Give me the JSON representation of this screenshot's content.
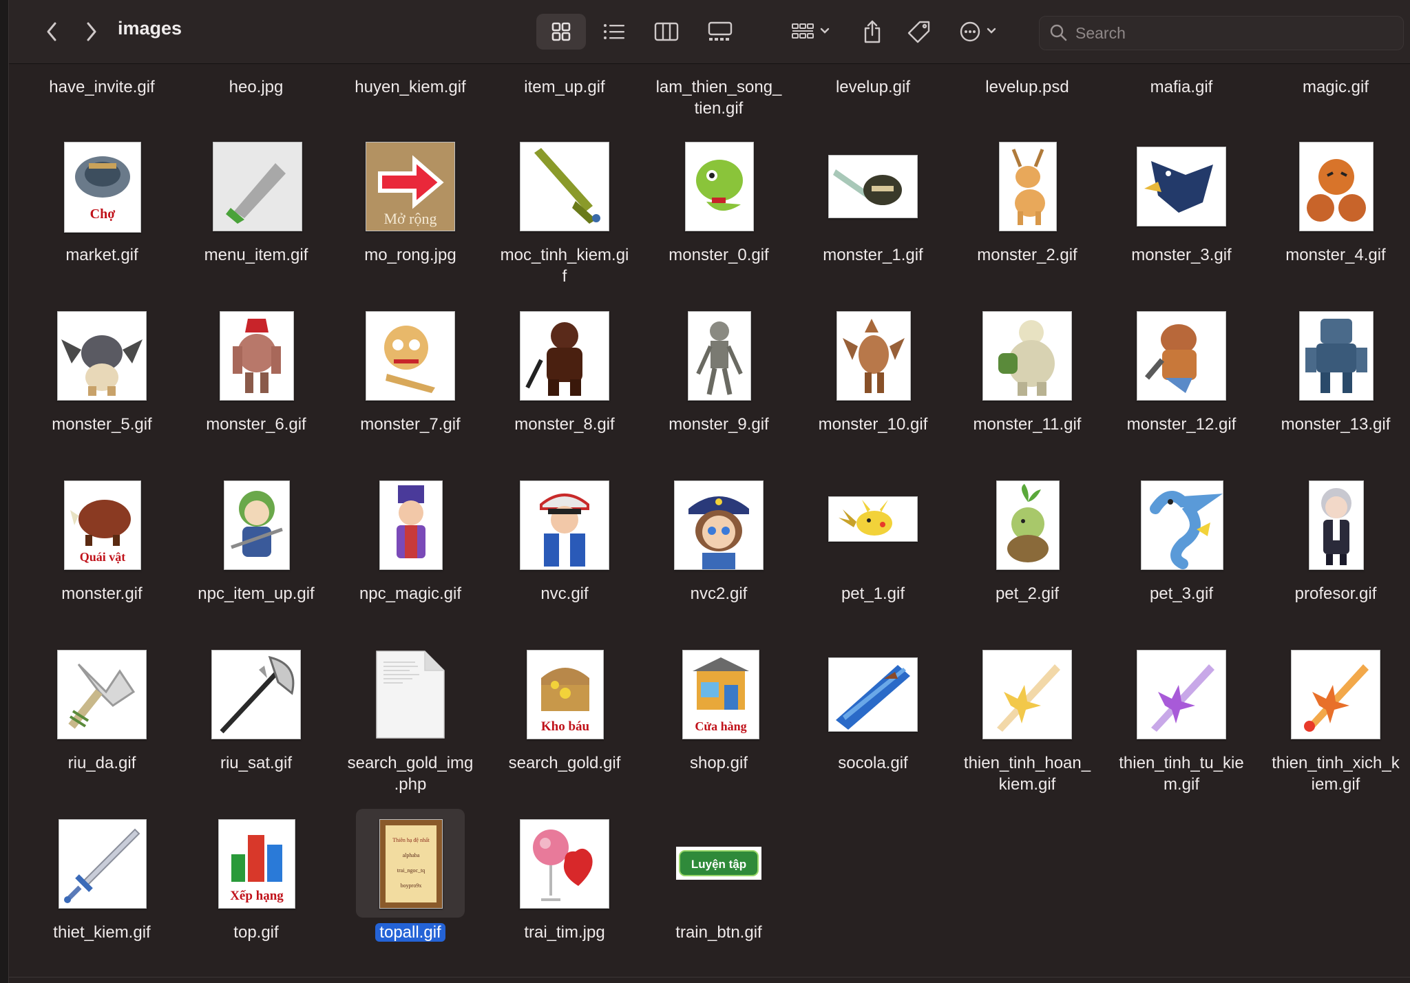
{
  "window": {
    "title": "images"
  },
  "toolbar": {
    "back_icon": "chevron-left-icon",
    "forward_icon": "chevron-right-icon",
    "views": [
      "icon-view-icon",
      "list-view-icon",
      "column-view-icon",
      "gallery-view-icon"
    ],
    "group_icon": "group-icon",
    "share_icon": "share-icon",
    "tag_icon": "tag-icon",
    "more_icon": "more-icon"
  },
  "search": {
    "placeholder": "Search"
  },
  "files": [
    {
      "name": "have_invite.gif"
    },
    {
      "name": "heo.jpg"
    },
    {
      "name": "huyen_kiem.gif"
    },
    {
      "name": "item_up.gif"
    },
    {
      "name": "lam_thien_song_\ntien.gif"
    },
    {
      "name": "levelup.gif"
    },
    {
      "name": "levelup.psd"
    },
    {
      "name": "mafia.gif"
    },
    {
      "name": "magic.gif"
    },
    {
      "name": "market.gif",
      "thumb_text": "Chợ"
    },
    {
      "name": "menu_item.gif"
    },
    {
      "name": "mo_rong.jpg",
      "thumb_text": "Mở rộng"
    },
    {
      "name": "moc_tinh_kiem.gi\nf"
    },
    {
      "name": "monster_0.gif"
    },
    {
      "name": "monster_1.gif"
    },
    {
      "name": "monster_2.gif"
    },
    {
      "name": "monster_3.gif"
    },
    {
      "name": "monster_4.gif"
    },
    {
      "name": "monster_5.gif"
    },
    {
      "name": "monster_6.gif"
    },
    {
      "name": "monster_7.gif"
    },
    {
      "name": "monster_8.gif"
    },
    {
      "name": "monster_9.gif"
    },
    {
      "name": "monster_10.gif"
    },
    {
      "name": "monster_11.gif"
    },
    {
      "name": "monster_12.gif"
    },
    {
      "name": "monster_13.gif"
    },
    {
      "name": "monster.gif",
      "thumb_text": "Quái vật"
    },
    {
      "name": "npc_item_up.gif"
    },
    {
      "name": "npc_magic.gif"
    },
    {
      "name": "nvc.gif"
    },
    {
      "name": "nvc2.gif"
    },
    {
      "name": "pet_1.gif"
    },
    {
      "name": "pet_2.gif"
    },
    {
      "name": "pet_3.gif"
    },
    {
      "name": "profesor.gif"
    },
    {
      "name": "riu_da.gif"
    },
    {
      "name": "riu_sat.gif"
    },
    {
      "name": "search_gold_img\n.php"
    },
    {
      "name": "search_gold.gif",
      "thumb_text": "Kho báu"
    },
    {
      "name": "shop.gif",
      "thumb_text": "Cửa hàng"
    },
    {
      "name": "socola.gif"
    },
    {
      "name": "thien_tinh_hoan_\nkiem.gif"
    },
    {
      "name": "thien_tinh_tu_kie\nm.gif"
    },
    {
      "name": "thien_tinh_xich_k\niem.gif"
    },
    {
      "name": "thiet_kiem.gif"
    },
    {
      "name": "top.gif",
      "thumb_text": "Xếp hạng"
    },
    {
      "name": "topall.gif",
      "selected": true,
      "thumb_text": "Thiên hạ đệ nhất\nalphaba\ntrai_ngoc_tq\nboypro9x"
    },
    {
      "name": "trai_tim.jpg"
    },
    {
      "name": "train_btn.gif",
      "thumb_text": "Luyện tập"
    }
  ]
}
